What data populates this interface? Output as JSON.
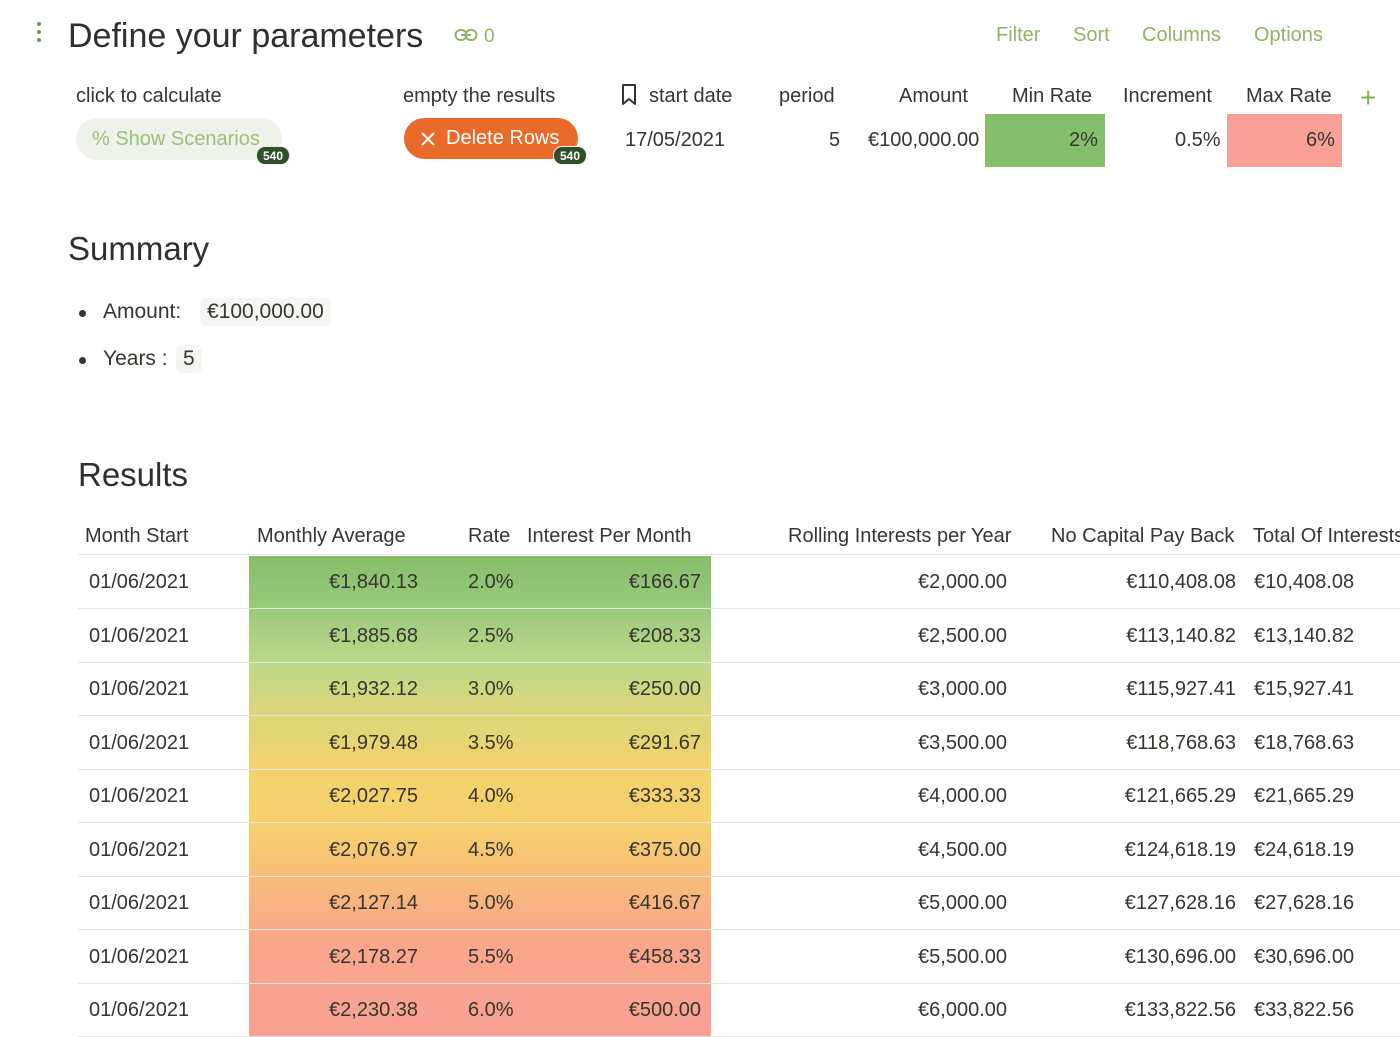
{
  "header": {
    "title": "Define your parameters",
    "link_count": "0",
    "menu": [
      "Filter",
      "Sort",
      "Columns",
      "Options"
    ]
  },
  "parameters": {
    "click_label": "click to calculate",
    "show_button": "% Show Scenarios",
    "show_badge": "540",
    "empty_label": "empty the results",
    "delete_button": "Delete Rows",
    "delete_badge": "540",
    "start_date_label": "start date",
    "start_date": "17/05/2021",
    "period_label": "period",
    "period": "5",
    "amount_label": "Amount",
    "amount": "€100,000.00",
    "min_rate_label": "Min Rate",
    "min_rate": "2%",
    "increment_label": "Increment",
    "increment": "0.5%",
    "max_rate_label": "Max Rate",
    "max_rate": "6%",
    "add_column": "+"
  },
  "summary": {
    "heading": "Summary",
    "amount_label": "Amount:",
    "amount_value": "€100,000.00",
    "years_label": "Years :",
    "years_value": "5"
  },
  "results": {
    "heading": "Results",
    "columns": [
      "Month Start",
      "Monthly Average",
      "Rate",
      "Interest Per Month",
      "Rolling Interests per Year",
      "No Capital Pay Back",
      "Total Of Interests"
    ],
    "rows": [
      [
        "01/06/2021",
        "€1,840.13",
        "2.0%",
        "€166.67",
        "€2,000.00",
        "€110,408.08",
        "€10,408.08"
      ],
      [
        "01/06/2021",
        "€1,885.68",
        "2.5%",
        "€208.33",
        "€2,500.00",
        "€113,140.82",
        "€13,140.82"
      ],
      [
        "01/06/2021",
        "€1,932.12",
        "3.0%",
        "€250.00",
        "€3,000.00",
        "€115,927.41",
        "€15,927.41"
      ],
      [
        "01/06/2021",
        "€1,979.48",
        "3.5%",
        "€291.67",
        "€3,500.00",
        "€118,768.63",
        "€18,768.63"
      ],
      [
        "01/06/2021",
        "€2,027.75",
        "4.0%",
        "€333.33",
        "€4,000.00",
        "€121,665.29",
        "€21,665.29"
      ],
      [
        "01/06/2021",
        "€2,076.97",
        "4.5%",
        "€375.00",
        "€4,500.00",
        "€124,618.19",
        "€24,618.19"
      ],
      [
        "01/06/2021",
        "€2,127.14",
        "5.0%",
        "€416.67",
        "€5,000.00",
        "€127,628.16",
        "€27,628.16"
      ],
      [
        "01/06/2021",
        "€2,178.27",
        "5.5%",
        "€458.33",
        "€5,500.00",
        "€130,696.00",
        "€30,696.00"
      ],
      [
        "01/06/2021",
        "€2,230.38",
        "6.0%",
        "€500.00",
        "€6,000.00",
        "€133,822.56",
        "€33,822.56"
      ]
    ]
  },
  "colors": {
    "accent": "#8fb565",
    "delete": "#ea6a2a",
    "min_rate": "#86bf6b",
    "max_rate": "#f8a095"
  }
}
